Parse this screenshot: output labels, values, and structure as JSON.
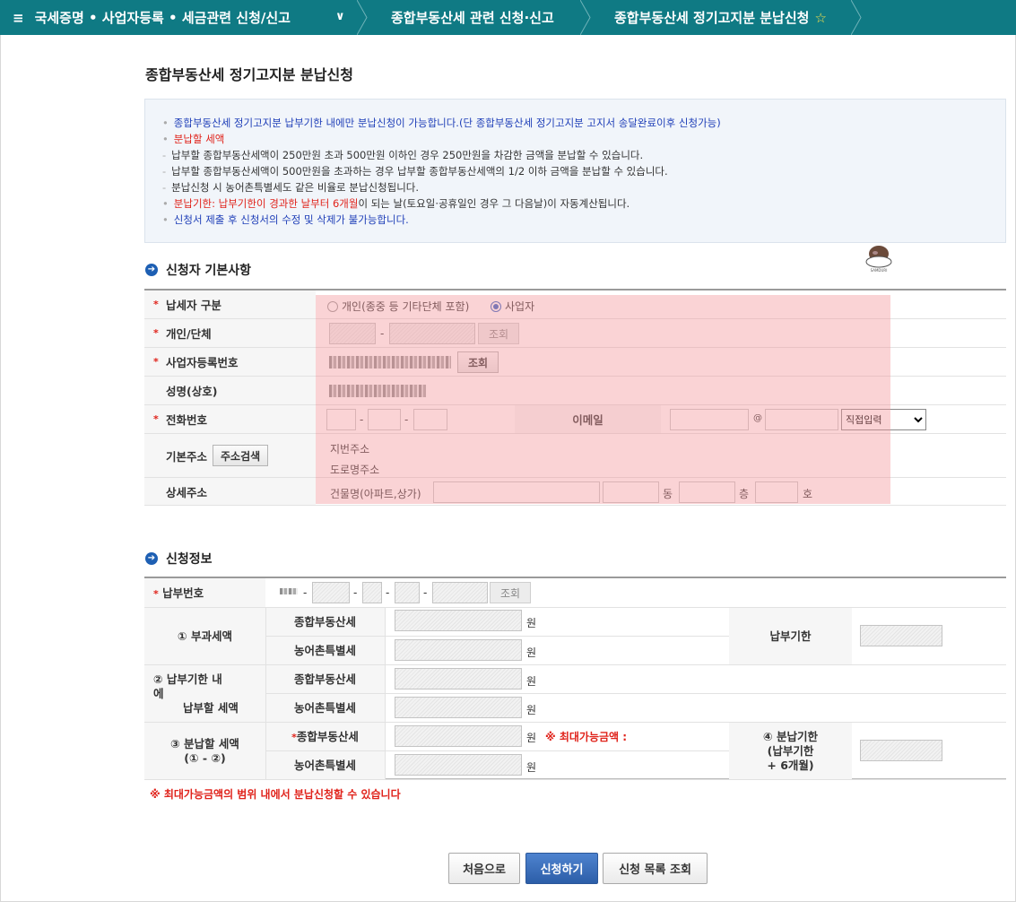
{
  "nav": {
    "menu_label": "국세증명 • 사업자등록 • 세금관련 신청/신고",
    "crumb1": "종합부동산세 관련 신청·신고",
    "crumb2": "종합부동산세 정기고지분 분납신청",
    "hamburger": "≡",
    "chevron": "∨",
    "star": "☆"
  },
  "page_title": "종합부동산세 정기고지분 분납신청",
  "notice": {
    "bullet": "•",
    "l1": "종합부동산세 정기고지분 납부기한 내에만 분납신청이 가능합니다.(단 종합부동산세 정기고지분 고지서 송달완료이후 신청가능)",
    "l2": "분납할 세액",
    "l3": "납부할 종합부동산세액이 250만원 초과 500만원 이하인 경우 250만원을 차감한 금액을 분납할 수 있습니다.",
    "l4": "납부할 종합부동산세액이 500만원을 초과하는 경우 납부할 종합부동산세액의 1/2 이하 금액을 분납할 수 있습니다.",
    "l5": "분납신청 시 농어촌특별세도 같은 비율로 분납신청됩니다.",
    "l6a": "분납기한: 납부기한이 경과한 날부터 6개월",
    "l6b": "이 되는 날(토요일·공휴일인 경우 그 다음날)이 자동계산됩니다.",
    "l7": "신청서 제출 후 신청서의 수정 및 삭제가 불가능합니다."
  },
  "section1": {
    "title": "신청자 기본사항",
    "req_mark": "*",
    "taxpayer_type_label": "납세자 구분",
    "radio_individual": "개인(종중 등 기타단체 포함)",
    "radio_business": "사업자",
    "individual_org_label": "개인/단체",
    "dash": "-",
    "lookup": "조회",
    "bizreg_label": "사업자등록번호",
    "name_label": "성명(상호)",
    "phone_label": "전화번호",
    "email_label": "이메일",
    "at": "@",
    "email_domain_option": "직접입력",
    "address_label": "기본주소",
    "address_search": "주소검색",
    "jibun_address": "지번주소",
    "road_address": "도로명주소",
    "detail_address_label": "상세주소",
    "building_label": "건물명(아파트,상가)",
    "dong": "동",
    "floor": "층",
    "ho": "호"
  },
  "section2": {
    "title": "신청정보",
    "req_mark": "*",
    "payment_no_label": "납부번호",
    "dash": "-",
    "lookup": "조회",
    "assessed_label": "① 부과세액",
    "within_label_1": "② 납부기한 내",
    "within_label_2": "에",
    "within_label_3": "납부할 세액",
    "install_label_1": "③ 분납할 세액",
    "install_label_2": "(① - ②)",
    "comprehensive": "종합부동산세",
    "rural": "농어촌특별세",
    "won": "원",
    "max_amount": "※ 최대가능금액 :",
    "due_label": "납부기한",
    "install_due_1": "④ 분납기한",
    "install_due_2": "(납부기한",
    "install_due_3": "+ 6개월)"
  },
  "warning": "※ 최대가능금액의 범위 내에서 분납신청할 수 있습니다",
  "buttons": {
    "home": "처음으로",
    "apply": "신청하기",
    "list": "신청 목록 조회"
  },
  "colors": {
    "nav_bg": "#0f7a84",
    "highlight_overlay": "#f4969b",
    "primary_button": "#2c5ea8",
    "required": "#e0231b"
  }
}
